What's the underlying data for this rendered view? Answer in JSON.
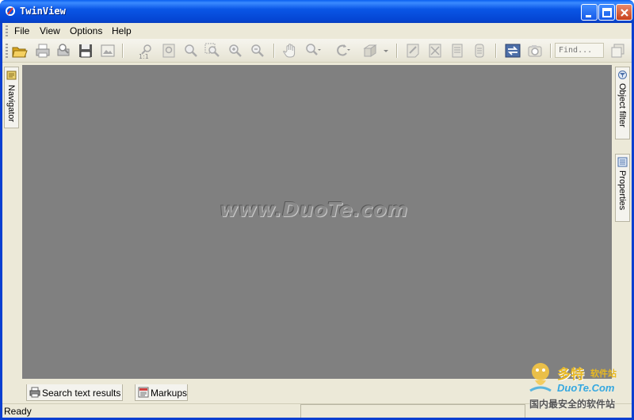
{
  "window": {
    "title": "TwinView"
  },
  "menu": [
    {
      "label": "File"
    },
    {
      "label": "View"
    },
    {
      "label": "Options"
    },
    {
      "label": "Help"
    }
  ],
  "toolbar": {
    "find_placeholder": "Find...",
    "tools": [
      "open-icon",
      "print-icon",
      "print-preview-icon",
      "save-icon",
      "export-icon",
      "zoom-1to1-icon",
      "zoom-page-icon",
      "zoom-icon",
      "zoom-window-icon",
      "zoom-in-icon",
      "zoom-out-icon",
      "pan-hand-icon",
      "zoom-dropdown-icon",
      "rotate-icon",
      "3d-box-icon",
      "edit-markup-icon",
      "cut-markup-icon",
      "page-markup-icon",
      "layers-icon",
      "compare-icon",
      "camera-icon",
      "copy-icon"
    ]
  },
  "workspace": {
    "watermark": "www.DuoTe.com",
    "background": "#808080"
  },
  "side_tabs": {
    "left": [
      {
        "label": "Navigator"
      }
    ],
    "right": [
      {
        "label": "Object filter"
      },
      {
        "label": "Properties"
      }
    ]
  },
  "bottom_tabs": [
    {
      "label": "Search text results"
    },
    {
      "label": "Markups"
    }
  ],
  "status": {
    "text": "Ready"
  },
  "corner_logo": {
    "brand": "多特",
    "brand_sub": "软件站",
    "url": "DuoTe.Com",
    "tagline": "国内最安全的软件站"
  }
}
